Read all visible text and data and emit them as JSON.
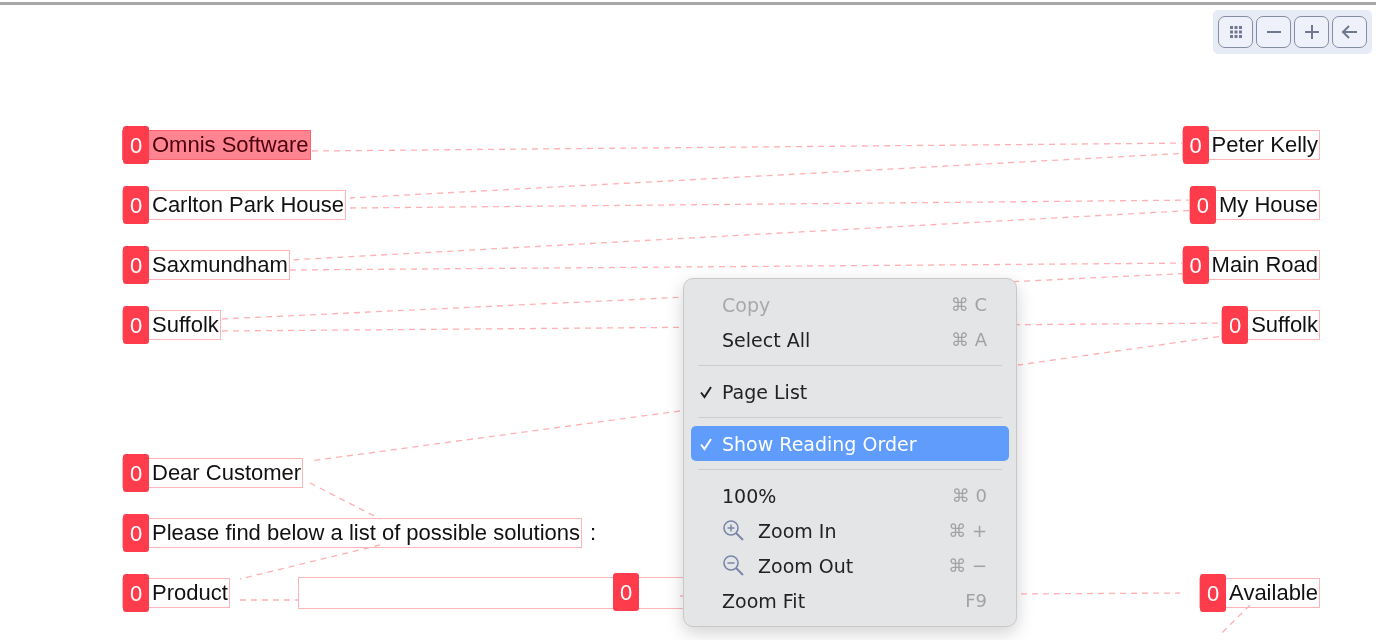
{
  "toolbar": {
    "buttons": [
      {
        "kind": "grid"
      },
      {
        "kind": "minus"
      },
      {
        "kind": "plus"
      },
      {
        "kind": "back"
      }
    ]
  },
  "document": {
    "rows": [
      {
        "left": {
          "text": "Omnis Software",
          "badge": "0",
          "selected": true
        },
        "right": {
          "text": "Peter Kelly",
          "badge": "0",
          "selected": false
        }
      },
      {
        "left": {
          "text": "Carlton Park House",
          "badge": "0",
          "selected": false
        },
        "right": {
          "text": "My House",
          "badge": "0",
          "selected": false
        }
      },
      {
        "left": {
          "text": "Saxmundham",
          "badge": "0",
          "selected": false
        },
        "right": {
          "text": "Main Road",
          "badge": "0",
          "selected": false
        }
      },
      {
        "left": {
          "text": "Suffolk",
          "badge": "0",
          "selected": false
        },
        "right": {
          "text": "Suffolk",
          "badge": "0",
          "selected": false
        }
      },
      {
        "left": {
          "text": "Dear Customer",
          "badge": "0",
          "selected": false
        }
      },
      {
        "left": {
          "text": "Please find below a list of possible solutions",
          "badge": "0",
          "selected": false,
          "trailing": ":"
        }
      },
      {
        "left": {
          "text": "Product",
          "badge": "0",
          "selected": false
        },
        "middle": {
          "badge": "0",
          "selected": false
        },
        "right": {
          "text": "Available",
          "badge": "0",
          "selected": false
        }
      }
    ]
  },
  "context_menu": {
    "items": [
      {
        "kind": "item",
        "label": "Copy",
        "shortcut": "⌘ C",
        "disabled": true,
        "checked": false,
        "selected": false
      },
      {
        "kind": "item",
        "label": "Select All",
        "shortcut": "⌘ A",
        "disabled": false,
        "checked": false,
        "selected": false
      },
      {
        "kind": "separator"
      },
      {
        "kind": "item",
        "label": "Page List",
        "disabled": false,
        "checked": true,
        "selected": false
      },
      {
        "kind": "separator"
      },
      {
        "kind": "item",
        "label": "Show Reading Order",
        "disabled": false,
        "checked": true,
        "selected": true
      },
      {
        "kind": "separator"
      },
      {
        "kind": "item",
        "label": "100%",
        "shortcut": "⌘ 0",
        "disabled": false,
        "checked": false,
        "selected": false
      },
      {
        "kind": "zoom_in",
        "label": "Zoom In",
        "shortcut": "⌘ +",
        "disabled": false,
        "checked": false,
        "selected": false
      },
      {
        "kind": "zoom_out",
        "label": "Zoom Out",
        "shortcut": "⌘ −",
        "disabled": false,
        "checked": false,
        "selected": false
      },
      {
        "kind": "item",
        "label": "Zoom Fit",
        "shortcut": "F9",
        "disabled": false,
        "checked": false,
        "selected": false
      }
    ]
  }
}
